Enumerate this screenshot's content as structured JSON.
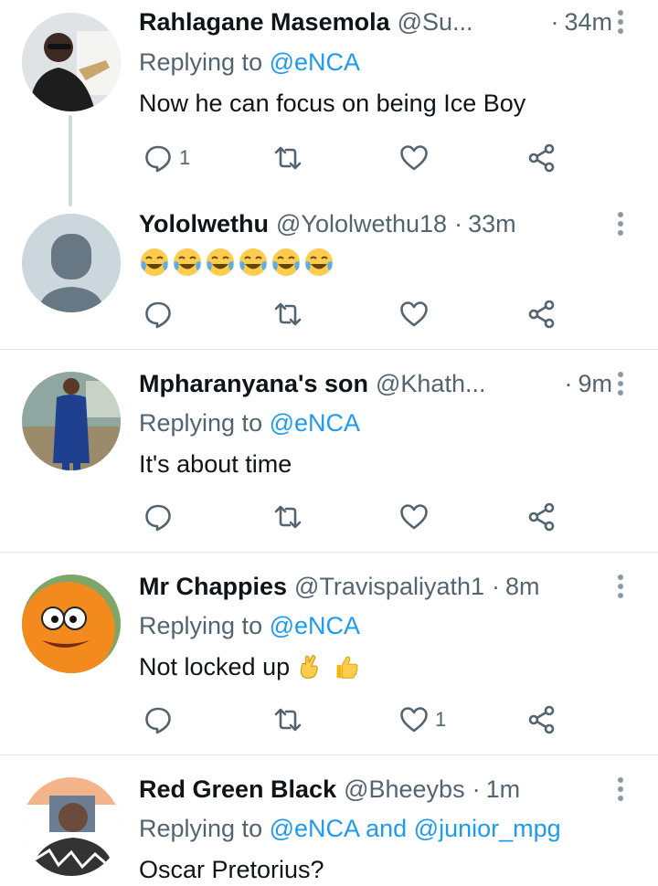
{
  "tweets": [
    {
      "name": "Rahlagane Masemola",
      "handle": "@Su...",
      "time": "34m",
      "replying_prefix": "Replying to",
      "replying_to": "@eNCA",
      "text": "Now he can focus on being Ice Boy",
      "reply_count": "1",
      "like_count": ""
    },
    {
      "name": "Yololwethu",
      "handle": "@Yololwethu18",
      "time": "33m",
      "emojis": [
        "face-with-tears-of-joy",
        "face-with-tears-of-joy",
        "face-with-tears-of-joy",
        "face-with-tears-of-joy",
        "face-with-tears-of-joy",
        "face-with-tears-of-joy"
      ],
      "reply_count": "",
      "like_count": ""
    },
    {
      "name": "Mpharanyana's son",
      "handle": "@Khath...",
      "time": "9m",
      "replying_prefix": "Replying to",
      "replying_to": "@eNCA",
      "text": "It's about time",
      "reply_count": "",
      "like_count": ""
    },
    {
      "name": "Mr Chappies",
      "handle": "@Travispaliyath1",
      "time": "8m",
      "replying_prefix": "Replying to",
      "replying_to": "@eNCA",
      "text": "Not locked up",
      "text_emojis": [
        "crossed-fingers-icon",
        "thumbs-up-icon"
      ],
      "reply_count": "",
      "like_count": "1"
    },
    {
      "name": "Red Green Black",
      "handle": "@Bheeybs",
      "time": "1m",
      "replying_prefix": "Replying to",
      "replying_to": "@eNCA",
      "replying_and": "and",
      "replying_to_2": "@junior_mpg",
      "text": "Oscar Pretorius?"
    }
  ],
  "separator": "·",
  "colors": {
    "text": "#0f1419",
    "secondary": "#536471",
    "link": "#1d9bf0",
    "divider": "#e1e6ea",
    "thread_line": "#cfd9de"
  },
  "icons": [
    "reply-icon",
    "retweet-icon",
    "like-icon",
    "share-icon",
    "more-icon"
  ]
}
